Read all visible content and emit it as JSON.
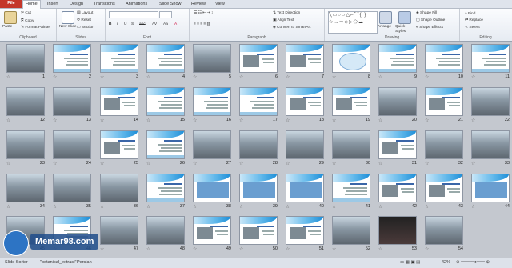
{
  "tabs": [
    "File",
    "Home",
    "Insert",
    "Design",
    "Transitions",
    "Animations",
    "Slide Show",
    "Review",
    "View"
  ],
  "ribbon": {
    "clipboard": {
      "label": "Clipboard",
      "paste": "Paste",
      "cut": "Cut",
      "copy": "Copy",
      "format_painter": "Format Painter"
    },
    "slides": {
      "label": "Slides",
      "new_slide": "New Slide",
      "layout": "Layout",
      "reset": "Reset",
      "section": "Section"
    },
    "font": {
      "label": "Font"
    },
    "paragraph": {
      "label": "Paragraph",
      "text_direction": "Text Direction",
      "align_text": "Align Text",
      "convert_smartart": "Convert to SmartArt"
    },
    "drawing": {
      "label": "Drawing",
      "arrange": "Arrange",
      "quick_styles": "Quick Styles",
      "shape_fill": "Shape Fill",
      "shape_outline": "Shape Outline",
      "shape_effects": "Shape Effects"
    },
    "editing": {
      "label": "Editing",
      "find": "Find",
      "replace": "Replace",
      "select": "Select"
    }
  },
  "slides": [
    {
      "n": "1",
      "k": "photo"
    },
    {
      "n": "2",
      "k": "text"
    },
    {
      "n": "3",
      "k": "text"
    },
    {
      "n": "4",
      "k": "text"
    },
    {
      "n": "5",
      "k": "photo"
    },
    {
      "n": "6",
      "k": "mixed"
    },
    {
      "n": "7",
      "k": "mixed"
    },
    {
      "n": "8",
      "k": "diagram"
    },
    {
      "n": "9",
      "k": "text"
    },
    {
      "n": "10",
      "k": "text"
    },
    {
      "n": "11",
      "k": "text"
    },
    {
      "n": "12",
      "k": "photo"
    },
    {
      "n": "13",
      "k": "photo"
    },
    {
      "n": "14",
      "k": "mixed"
    },
    {
      "n": "15",
      "k": "text"
    },
    {
      "n": "16",
      "k": "text"
    },
    {
      "n": "17",
      "k": "text"
    },
    {
      "n": "18",
      "k": "mixed"
    },
    {
      "n": "19",
      "k": "mixed"
    },
    {
      "n": "20",
      "k": "photo"
    },
    {
      "n": "21",
      "k": "mixed"
    },
    {
      "n": "22",
      "k": "photo"
    },
    {
      "n": "23",
      "k": "photo"
    },
    {
      "n": "24",
      "k": "photo"
    },
    {
      "n": "25",
      "k": "mixed"
    },
    {
      "n": "26",
      "k": "text"
    },
    {
      "n": "27",
      "k": "photo"
    },
    {
      "n": "28",
      "k": "photo"
    },
    {
      "n": "29",
      "k": "photo"
    },
    {
      "n": "30",
      "k": "photo"
    },
    {
      "n": "31",
      "k": "mixed"
    },
    {
      "n": "32",
      "k": "photo"
    },
    {
      "n": "33",
      "k": "photo"
    },
    {
      "n": "34",
      "k": "photo"
    },
    {
      "n": "35",
      "k": "photo"
    },
    {
      "n": "36",
      "k": "photo"
    },
    {
      "n": "37",
      "k": "text"
    },
    {
      "n": "38",
      "k": "plan"
    },
    {
      "n": "39",
      "k": "plan"
    },
    {
      "n": "40",
      "k": "plan"
    },
    {
      "n": "41",
      "k": "text"
    },
    {
      "n": "42",
      "k": "mixed"
    },
    {
      "n": "43",
      "k": "mixed"
    },
    {
      "n": "44",
      "k": "plan"
    },
    {
      "n": "45",
      "k": "photo"
    },
    {
      "n": "46",
      "k": "text"
    },
    {
      "n": "47",
      "k": "photo"
    },
    {
      "n": "48",
      "k": "photo"
    },
    {
      "n": "49",
      "k": "mixed"
    },
    {
      "n": "50",
      "k": "mixed"
    },
    {
      "n": "51",
      "k": "mixed"
    },
    {
      "n": "52",
      "k": "photo"
    },
    {
      "n": "53",
      "k": "dark"
    },
    {
      "n": "54",
      "k": "photo"
    }
  ],
  "status": {
    "view": "Slide Sorter",
    "theme": "\"botanical_extract\"",
    "language": "Persian",
    "zoom": "42%"
  },
  "watermark": {
    "text": "Memar98.com"
  }
}
